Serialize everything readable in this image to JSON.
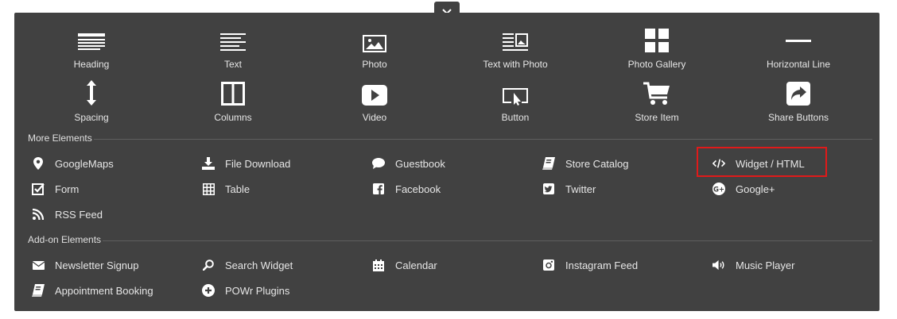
{
  "close_label": "×",
  "tiles_row1": [
    {
      "label": "Heading",
      "icon": "heading-icon"
    },
    {
      "label": "Text",
      "icon": "text-icon"
    },
    {
      "label": "Photo",
      "icon": "photo-icon"
    },
    {
      "label": "Text with Photo",
      "icon": "text-with-photo-icon"
    },
    {
      "label": "Photo Gallery",
      "icon": "photo-gallery-icon"
    },
    {
      "label": "Horizontal Line",
      "icon": "horizontal-line-icon"
    }
  ],
  "tiles_row2": [
    {
      "label": "Spacing",
      "icon": "spacing-icon"
    },
    {
      "label": "Columns",
      "icon": "columns-icon"
    },
    {
      "label": "Video",
      "icon": "video-icon"
    },
    {
      "label": "Button",
      "icon": "button-icon"
    },
    {
      "label": "Store Item",
      "icon": "cart-icon"
    },
    {
      "label": "Share Buttons",
      "icon": "share-icon"
    }
  ],
  "more_elements": {
    "title": "More Elements",
    "items": [
      {
        "label": "GoogleMaps",
        "icon": "map-pin-icon"
      },
      {
        "label": "File Download",
        "icon": "download-icon"
      },
      {
        "label": "Guestbook",
        "icon": "speech-bubble-icon"
      },
      {
        "label": "Store Catalog",
        "icon": "book-icon"
      },
      {
        "label": "Widget / HTML",
        "icon": "code-icon"
      },
      {
        "label": "Form",
        "icon": "checkbox-icon"
      },
      {
        "label": "Table",
        "icon": "table-icon"
      },
      {
        "label": "Facebook",
        "icon": "facebook-icon"
      },
      {
        "label": "Twitter",
        "icon": "twitter-icon"
      },
      {
        "label": "Google+",
        "icon": "google-plus-icon"
      },
      {
        "label": "RSS Feed",
        "icon": "rss-icon"
      }
    ]
  },
  "addon_elements": {
    "title": "Add-on Elements",
    "items": [
      {
        "label": "Newsletter Signup",
        "icon": "envelope-icon"
      },
      {
        "label": "Search Widget",
        "icon": "search-icon"
      },
      {
        "label": "Calendar",
        "icon": "calendar-icon"
      },
      {
        "label": "Instagram Feed",
        "icon": "instagram-icon"
      },
      {
        "label": "Music Player",
        "icon": "speaker-icon"
      },
      {
        "label": "Appointment Booking",
        "icon": "book-icon"
      },
      {
        "label": "POWr Plugins",
        "icon": "plus-circle-icon"
      }
    ]
  },
  "colors": {
    "panel": "#414141",
    "text": "#e6e6e6",
    "highlight": "#e01a1a"
  }
}
